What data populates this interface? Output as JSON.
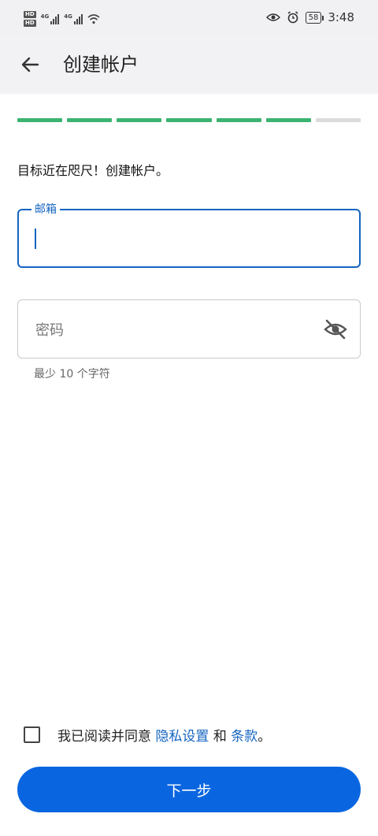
{
  "status_bar": {
    "hd_label_1": "HD",
    "hd_label_2": "HD",
    "signal_label_1": "4G",
    "signal_label_2": "4G",
    "battery": "58",
    "time": "3:48",
    "icons": [
      "hd-icon",
      "signal-icon",
      "wifi-icon",
      "eye-icon",
      "alarm-icon",
      "battery-icon"
    ]
  },
  "appbar": {
    "title": "创建帐户",
    "back_icon": "arrow-left-icon"
  },
  "progress": {
    "total_steps": 7,
    "completed_steps": 6,
    "done_color": "#3cb371",
    "pending_color": "#dcdcdc"
  },
  "headline": "目标近在咫尺！创建帐户。",
  "email": {
    "label": "邮箱",
    "value": ""
  },
  "password": {
    "placeholder": "密码",
    "value": "",
    "visibility_icon": "eye-off-icon",
    "hint": "最少 10 个字符"
  },
  "terms": {
    "prefix": "我已阅读并同意",
    "privacy_link": "隐私设置",
    "conjunction": "和",
    "terms_link": "条款",
    "suffix": "。",
    "checked": false
  },
  "next_button": {
    "label": "下一步"
  },
  "colors": {
    "accent": "#1565c0",
    "button": "#0a66e0"
  }
}
